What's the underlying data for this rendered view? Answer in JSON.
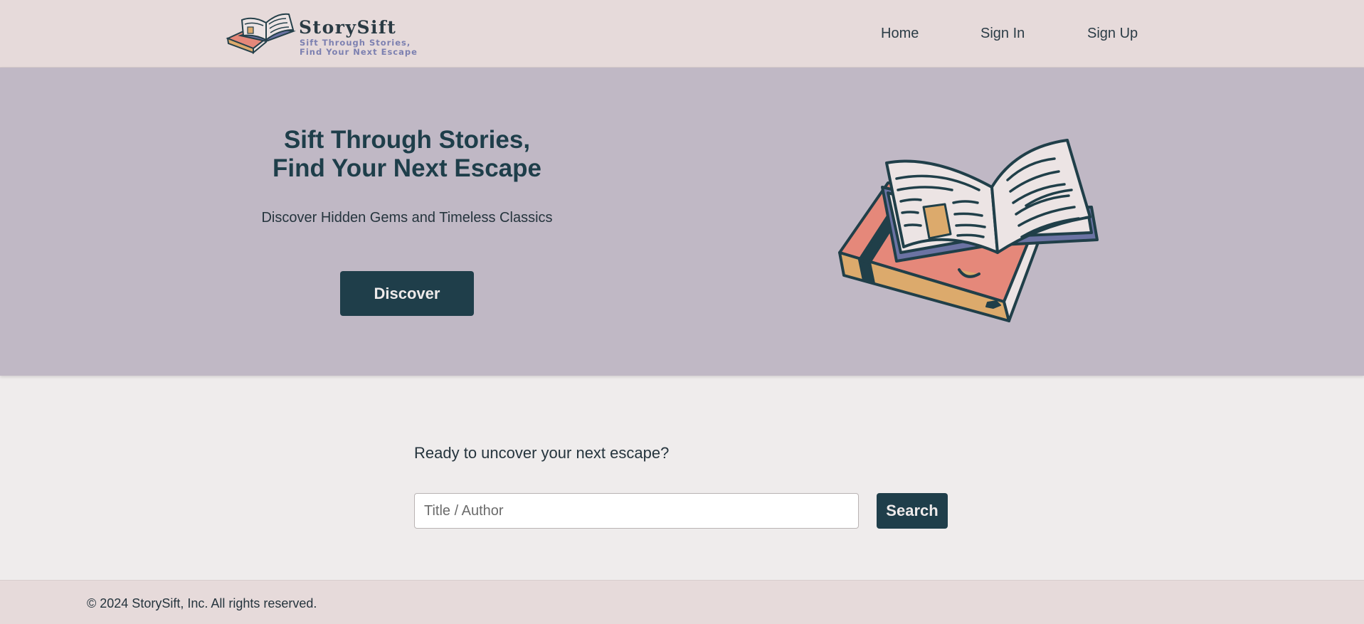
{
  "brand": {
    "name": "StorySift",
    "tagline": "Sift Through Stories,\nFind Your Next Escape"
  },
  "nav": {
    "home": "Home",
    "sign_in": "Sign In",
    "sign_up": "Sign Up"
  },
  "hero": {
    "title": "Sift Through Stories,\nFind Your Next Escape",
    "subtitle": "Discover Hidden Gems and Timeless Classics",
    "cta_label": "Discover",
    "illustration_icon": "books-illustration-icon"
  },
  "search": {
    "prompt": "Ready to uncover your next escape?",
    "placeholder": "Title / Author",
    "value": "",
    "button_label": "Search"
  },
  "footer": {
    "copyright": "© 2024 StorySift, Inc. All rights reserved."
  },
  "colors": {
    "header_bg": "#e6dada",
    "hero_bg": "#c0b8c5",
    "accent_dark": "#1f3e4a",
    "page_bg": "#efecec",
    "book_coral": "#e5887a",
    "book_tan": "#dcaa6c",
    "book_purple": "#6b73a3",
    "paper": "#ece4e4"
  }
}
